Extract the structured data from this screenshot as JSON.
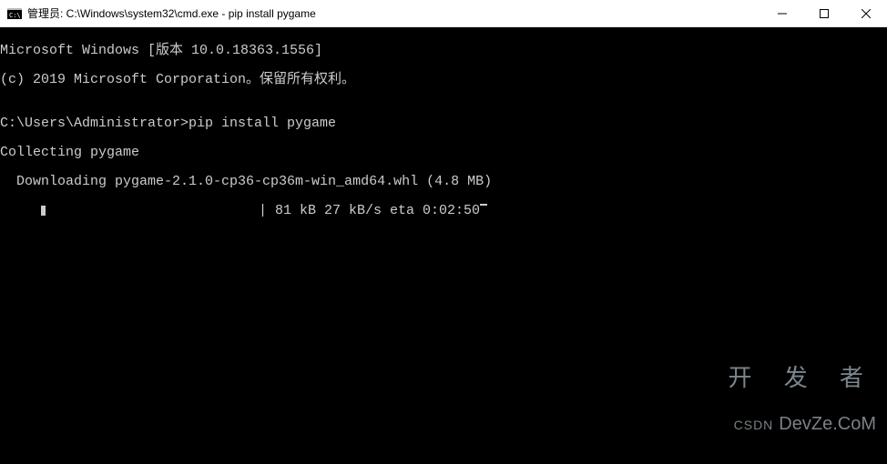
{
  "titlebar": {
    "icon_label": "C:\\",
    "title": "管理员: C:\\Windows\\system32\\cmd.exe - pip  install pygame"
  },
  "window_controls": {
    "minimize": "─",
    "maximize": "☐",
    "close": "✕"
  },
  "terminal": {
    "line1": "Microsoft Windows [版本 10.0.18363.1556]",
    "line2": "(c) 2019 Microsoft Corporation。保留所有权利。",
    "line3": "",
    "line4": "C:\\Users\\Administrator>pip install pygame",
    "line5": "Collecting pygame",
    "line6": "  Downloading pygame-2.1.0-cp36-cp36m-win_amd64.whl (4.8 MB)",
    "progress": {
      "indent": "     ",
      "percent_filled": 2,
      "stats": " | 81 kB 27 kB/s eta 0:02:50"
    }
  },
  "watermark": {
    "big": "开 发 者",
    "csdn": "CSDN",
    "devze": "DevZe.CoM"
  }
}
